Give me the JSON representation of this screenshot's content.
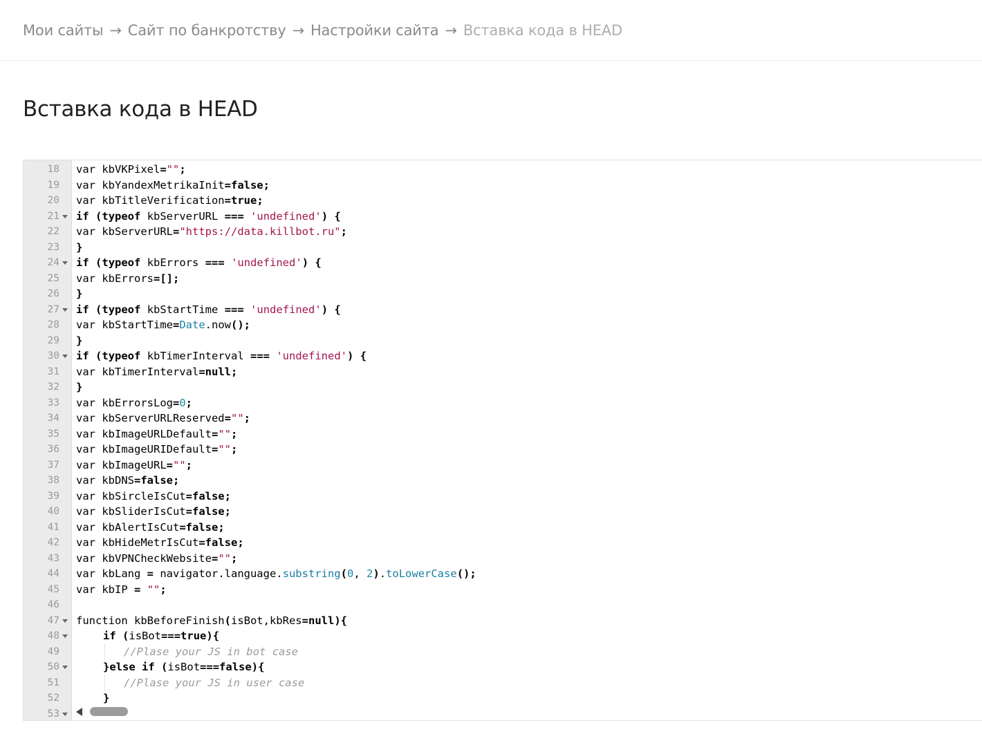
{
  "breadcrumb": {
    "items": [
      "Мои сайты",
      "Сайт по банкротству",
      "Настройки сайта"
    ],
    "current": "Вставка кода в HEAD",
    "separator": "→"
  },
  "page": {
    "title": "Вставка кода в HEAD"
  },
  "editor": {
    "lines": [
      {
        "n": "18",
        "t": "var kbVKPixel=\"\";"
      },
      {
        "n": "19",
        "t": "var kbYandexMetrikaInit=false;"
      },
      {
        "n": "20",
        "t": "var kbTitleVerification=true;"
      },
      {
        "n": "21",
        "t": "if (typeof kbServerURL === 'undefined') {"
      },
      {
        "n": "22",
        "t": "var kbServerURL=\"https://data.killbot.ru\";"
      },
      {
        "n": "23",
        "t": "}"
      },
      {
        "n": "24",
        "t": "if (typeof kbErrors === 'undefined') {"
      },
      {
        "n": "25",
        "t": "var kbErrors=[];"
      },
      {
        "n": "26",
        "t": "}"
      },
      {
        "n": "27",
        "t": "if (typeof kbStartTime === 'undefined') {"
      },
      {
        "n": "28",
        "t": "var kbStartTime=Date.now();"
      },
      {
        "n": "29",
        "t": "}"
      },
      {
        "n": "30",
        "t": "if (typeof kbTimerInterval === 'undefined') {"
      },
      {
        "n": "31",
        "t": "var kbTimerInterval=null;"
      },
      {
        "n": "32",
        "t": "}"
      },
      {
        "n": "33",
        "t": "var kbErrorsLog=0;"
      },
      {
        "n": "34",
        "t": "var kbServerURLReserved=\"\";"
      },
      {
        "n": "35",
        "t": "var kbImageURLDefault=\"\";"
      },
      {
        "n": "36",
        "t": "var kbImageURIDefault=\"\";"
      },
      {
        "n": "37",
        "t": "var kbImageURL=\"\";"
      },
      {
        "n": "38",
        "t": "var kbDNS=false;"
      },
      {
        "n": "39",
        "t": "var kbSircleIsCut=false;"
      },
      {
        "n": "40",
        "t": "var kbSliderIsCut=false;"
      },
      {
        "n": "41",
        "t": "var kbAlertIsCut=false;"
      },
      {
        "n": "42",
        "t": "var kbHideMetrIsCut=false;"
      },
      {
        "n": "43",
        "t": "var kbVPNCheckWebsite=\"\";"
      },
      {
        "n": "44",
        "t": "var kbLang = navigator.language.substring(0, 2).toLowerCase();"
      },
      {
        "n": "45",
        "t": "var kbIP = \"\";"
      },
      {
        "n": "46",
        "t": ""
      },
      {
        "n": "47",
        "t": "function kbBeforeFinish(isBot,kbRes=null){"
      },
      {
        "n": "48",
        "t": "if (isBot===true){"
      },
      {
        "n": "49",
        "t": "//Plase your JS in bot case"
      },
      {
        "n": "50",
        "t": "}else if (isBot===false){"
      },
      {
        "n": "51",
        "t": "//Plase your JS in user case"
      },
      {
        "n": "52",
        "t": "}"
      },
      {
        "n": "53",
        "t": ""
      }
    ],
    "fold_lines": [
      "21",
      "24",
      "27",
      "30",
      "47",
      "48",
      "50",
      "53"
    ],
    "indent1_lines": [
      "48",
      "50",
      "52"
    ],
    "indent2_lines": [
      "49",
      "51"
    ],
    "colors": {
      "string": "#a31550",
      "number": "#1a8ca0",
      "builtin": "#1a7fa3",
      "comment": "#9a9a9a"
    }
  }
}
